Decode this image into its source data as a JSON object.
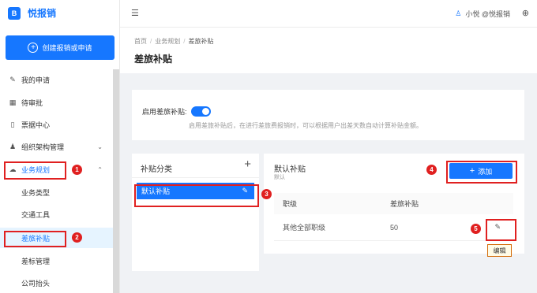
{
  "app": {
    "logo_glyph": "B",
    "name": "悦报销",
    "brand_color": "#1677ff"
  },
  "sidebar": {
    "create_button": "创建报销或申请",
    "items": [
      {
        "label": "我的申请",
        "icon": "edit-icon"
      },
      {
        "label": "待审批",
        "icon": "grid-icon"
      },
      {
        "label": "票据中心",
        "icon": "document-icon"
      },
      {
        "label": "组织架构管理",
        "icon": "org-icon"
      },
      {
        "label": "业务规划",
        "icon": "cloud-icon"
      }
    ],
    "subitems": [
      {
        "label": "业务类型"
      },
      {
        "label": "交通工具"
      },
      {
        "label": "差旅补贴"
      },
      {
        "label": "差标管理"
      },
      {
        "label": "公司抬头"
      }
    ]
  },
  "topbar": {
    "user_label": "小悦 @悦报销"
  },
  "page": {
    "breadcrumbs": [
      "首页",
      "业务规划",
      "差旅补贴"
    ],
    "title": "差旅补贴"
  },
  "switch_card": {
    "label": "启用差旅补贴:",
    "enabled": true,
    "hint": "启用差旅补贴后，在进行差旅费报销时，可以根据用户出差天数自动计算补贴金额。"
  },
  "category_panel": {
    "title": "补贴分类",
    "add_glyph": "+",
    "items": [
      {
        "label": "默认补贴"
      }
    ]
  },
  "detail_panel": {
    "title": "默认补贴",
    "subtitle": "默认",
    "add_button": "添加",
    "columns": [
      "职级",
      "差旅补贴"
    ],
    "rows": [
      {
        "level": "其他全部职级",
        "amount": "50"
      }
    ],
    "edit_tooltip": "编辑"
  },
  "annotations": {
    "color": "#e02020",
    "badges": [
      "1",
      "2",
      "3",
      "4",
      "5"
    ]
  }
}
